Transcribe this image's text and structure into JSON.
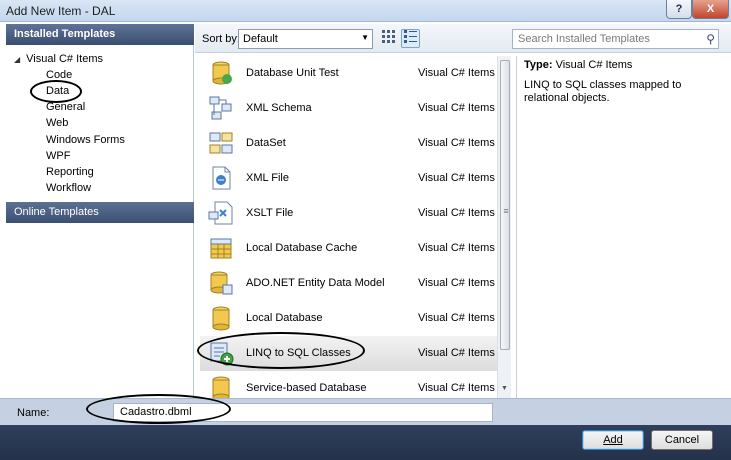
{
  "window": {
    "title": "Add New Item - DAL",
    "help_label": "?",
    "close_label": "X"
  },
  "left_panel": {
    "installed_header": "Installed Templates",
    "tree_root": "Visual C# Items",
    "tree_items": [
      "Code",
      "Data",
      "General",
      "Web",
      "Windows Forms",
      "WPF",
      "Reporting",
      "Workflow"
    ],
    "online_header": "Online Templates"
  },
  "toolbar": {
    "sort_label": "Sort by:",
    "sort_value": "Default",
    "search_placeholder": "Search Installed Templates"
  },
  "templates": [
    {
      "name": "Database Unit Test",
      "category": "Visual C# Items",
      "icon": "database-unit-test-icon"
    },
    {
      "name": "XML Schema",
      "category": "Visual C# Items",
      "icon": "xml-schema-icon"
    },
    {
      "name": "DataSet",
      "category": "Visual C# Items",
      "icon": "dataset-icon"
    },
    {
      "name": "XML File",
      "category": "Visual C# Items",
      "icon": "xml-file-icon"
    },
    {
      "name": "XSLT File",
      "category": "Visual C# Items",
      "icon": "xslt-file-icon"
    },
    {
      "name": "Local Database Cache",
      "category": "Visual C# Items",
      "icon": "local-database-cache-icon"
    },
    {
      "name": "ADO.NET Entity Data Model",
      "category": "Visual C# Items",
      "icon": "entity-data-model-icon"
    },
    {
      "name": "Local Database",
      "category": "Visual C# Items",
      "icon": "local-database-icon"
    },
    {
      "name": "LINQ to SQL Classes",
      "category": "Visual C# Items",
      "icon": "linq-to-sql-icon",
      "selected": true
    },
    {
      "name": "Service-based Database",
      "category": "Visual C# Items",
      "icon": "service-database-icon"
    }
  ],
  "description": {
    "type_label": "Type:",
    "type_value": "Visual C# Items",
    "text": "LINQ to SQL classes mapped to relational objects."
  },
  "name_field": {
    "label": "Name:",
    "value": "Cadastro.dbml"
  },
  "buttons": {
    "add": "Add",
    "cancel": "Cancel"
  },
  "colors": {
    "header_bg": "#3a4e72",
    "bottom_bar": "#2a3852",
    "name_row": "#c5d1e3",
    "selected_row": "#e6e6e6"
  }
}
